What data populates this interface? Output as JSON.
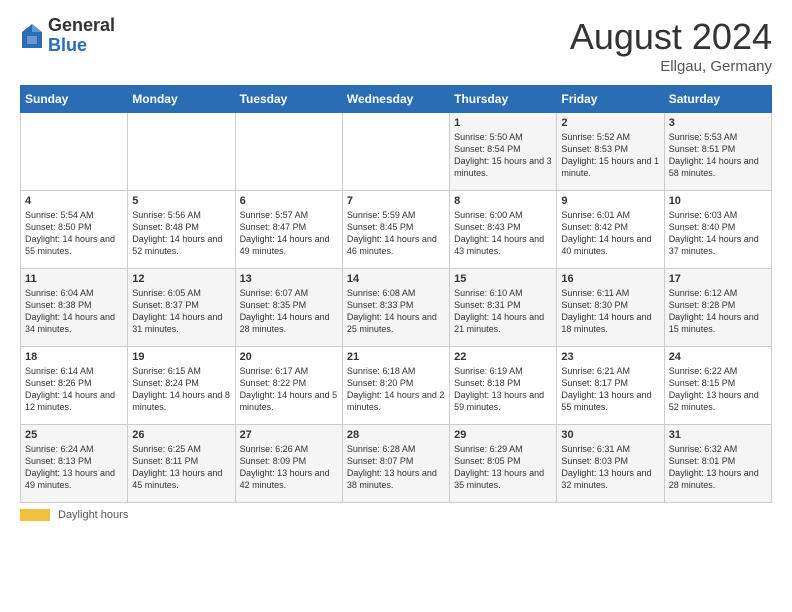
{
  "logo": {
    "general": "General",
    "blue": "Blue"
  },
  "title": "August 2024",
  "location": "Ellgau, Germany",
  "days_of_week": [
    "Sunday",
    "Monday",
    "Tuesday",
    "Wednesday",
    "Thursday",
    "Friday",
    "Saturday"
  ],
  "footer": {
    "daylight_label": "Daylight hours"
  },
  "weeks": [
    [
      {
        "day": "",
        "info": ""
      },
      {
        "day": "",
        "info": ""
      },
      {
        "day": "",
        "info": ""
      },
      {
        "day": "",
        "info": ""
      },
      {
        "day": "1",
        "info": "Sunrise: 5:50 AM\nSunset: 8:54 PM\nDaylight: 15 hours\nand 3 minutes."
      },
      {
        "day": "2",
        "info": "Sunrise: 5:52 AM\nSunset: 8:53 PM\nDaylight: 15 hours\nand 1 minute."
      },
      {
        "day": "3",
        "info": "Sunrise: 5:53 AM\nSunset: 8:51 PM\nDaylight: 14 hours\nand 58 minutes."
      }
    ],
    [
      {
        "day": "4",
        "info": "Sunrise: 5:54 AM\nSunset: 8:50 PM\nDaylight: 14 hours\nand 55 minutes."
      },
      {
        "day": "5",
        "info": "Sunrise: 5:56 AM\nSunset: 8:48 PM\nDaylight: 14 hours\nand 52 minutes."
      },
      {
        "day": "6",
        "info": "Sunrise: 5:57 AM\nSunset: 8:47 PM\nDaylight: 14 hours\nand 49 minutes."
      },
      {
        "day": "7",
        "info": "Sunrise: 5:59 AM\nSunset: 8:45 PM\nDaylight: 14 hours\nand 46 minutes."
      },
      {
        "day": "8",
        "info": "Sunrise: 6:00 AM\nSunset: 8:43 PM\nDaylight: 14 hours\nand 43 minutes."
      },
      {
        "day": "9",
        "info": "Sunrise: 6:01 AM\nSunset: 8:42 PM\nDaylight: 14 hours\nand 40 minutes."
      },
      {
        "day": "10",
        "info": "Sunrise: 6:03 AM\nSunset: 8:40 PM\nDaylight: 14 hours\nand 37 minutes."
      }
    ],
    [
      {
        "day": "11",
        "info": "Sunrise: 6:04 AM\nSunset: 8:38 PM\nDaylight: 14 hours\nand 34 minutes."
      },
      {
        "day": "12",
        "info": "Sunrise: 6:05 AM\nSunset: 8:37 PM\nDaylight: 14 hours\nand 31 minutes."
      },
      {
        "day": "13",
        "info": "Sunrise: 6:07 AM\nSunset: 8:35 PM\nDaylight: 14 hours\nand 28 minutes."
      },
      {
        "day": "14",
        "info": "Sunrise: 6:08 AM\nSunset: 8:33 PM\nDaylight: 14 hours\nand 25 minutes."
      },
      {
        "day": "15",
        "info": "Sunrise: 6:10 AM\nSunset: 8:31 PM\nDaylight: 14 hours\nand 21 minutes."
      },
      {
        "day": "16",
        "info": "Sunrise: 6:11 AM\nSunset: 8:30 PM\nDaylight: 14 hours\nand 18 minutes."
      },
      {
        "day": "17",
        "info": "Sunrise: 6:12 AM\nSunset: 8:28 PM\nDaylight: 14 hours\nand 15 minutes."
      }
    ],
    [
      {
        "day": "18",
        "info": "Sunrise: 6:14 AM\nSunset: 8:26 PM\nDaylight: 14 hours\nand 12 minutes."
      },
      {
        "day": "19",
        "info": "Sunrise: 6:15 AM\nSunset: 8:24 PM\nDaylight: 14 hours\nand 8 minutes."
      },
      {
        "day": "20",
        "info": "Sunrise: 6:17 AM\nSunset: 8:22 PM\nDaylight: 14 hours\nand 5 minutes."
      },
      {
        "day": "21",
        "info": "Sunrise: 6:18 AM\nSunset: 8:20 PM\nDaylight: 14 hours\nand 2 minutes."
      },
      {
        "day": "22",
        "info": "Sunrise: 6:19 AM\nSunset: 8:18 PM\nDaylight: 13 hours\nand 59 minutes."
      },
      {
        "day": "23",
        "info": "Sunrise: 6:21 AM\nSunset: 8:17 PM\nDaylight: 13 hours\nand 55 minutes."
      },
      {
        "day": "24",
        "info": "Sunrise: 6:22 AM\nSunset: 8:15 PM\nDaylight: 13 hours\nand 52 minutes."
      }
    ],
    [
      {
        "day": "25",
        "info": "Sunrise: 6:24 AM\nSunset: 8:13 PM\nDaylight: 13 hours\nand 49 minutes."
      },
      {
        "day": "26",
        "info": "Sunrise: 6:25 AM\nSunset: 8:11 PM\nDaylight: 13 hours\nand 45 minutes."
      },
      {
        "day": "27",
        "info": "Sunrise: 6:26 AM\nSunset: 8:09 PM\nDaylight: 13 hours\nand 42 minutes."
      },
      {
        "day": "28",
        "info": "Sunrise: 6:28 AM\nSunset: 8:07 PM\nDaylight: 13 hours\nand 38 minutes."
      },
      {
        "day": "29",
        "info": "Sunrise: 6:29 AM\nSunset: 8:05 PM\nDaylight: 13 hours\nand 35 minutes."
      },
      {
        "day": "30",
        "info": "Sunrise: 6:31 AM\nSunset: 8:03 PM\nDaylight: 13 hours\nand 32 minutes."
      },
      {
        "day": "31",
        "info": "Sunrise: 6:32 AM\nSunset: 8:01 PM\nDaylight: 13 hours\nand 28 minutes."
      }
    ]
  ]
}
